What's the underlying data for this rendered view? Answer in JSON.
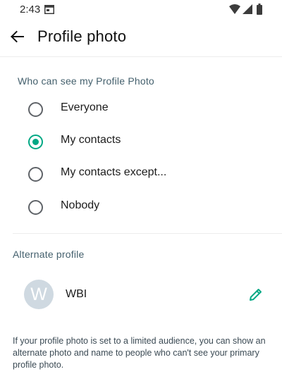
{
  "status_bar": {
    "time": "2:43",
    "icons": [
      "calendar-icon",
      "wifi-icon",
      "signal-icon",
      "battery-icon"
    ]
  },
  "header": {
    "title": "Profile photo",
    "back_icon": "back-arrow-icon"
  },
  "privacy": {
    "section_label": "Who can see my Profile Photo",
    "selected": "My contacts",
    "options": [
      {
        "label": "Everyone"
      },
      {
        "label": "My contacts"
      },
      {
        "label": "My contacts except..."
      },
      {
        "label": "Nobody"
      }
    ]
  },
  "alternate_profile": {
    "section_label": "Alternate profile",
    "avatar_letter": "W",
    "name": "WBI",
    "edit_icon": "pencil-icon",
    "description": "If your profile photo is set to a limited audience, you can show an alternate photo and name to people who can't see your primary profile photo."
  },
  "colors": {
    "accent": "#00a884",
    "section_label": "#44606d",
    "avatar_bg": "#cfd9e1"
  }
}
